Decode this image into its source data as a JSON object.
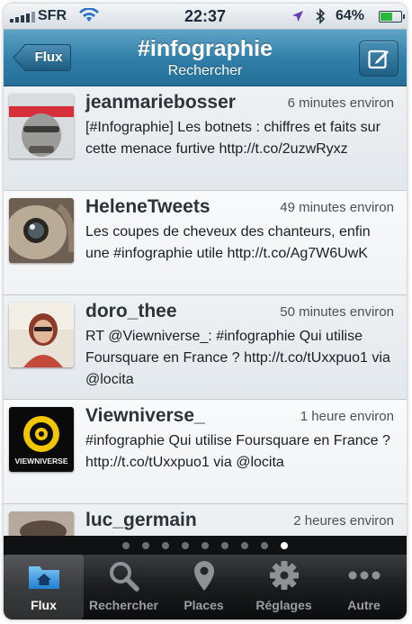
{
  "status_bar": {
    "carrier": "SFR",
    "time": "22:37",
    "battery": "64%",
    "battery_level": 0.64,
    "icons": [
      "signal-icon",
      "wifi-icon",
      "location-arrow-icon",
      "bluetooth-icon",
      "battery-icon"
    ]
  },
  "nav": {
    "back_label": "Flux",
    "title": "#infographie",
    "subtitle": "Rechercher",
    "compose_icon": "compose-icon",
    "colors": {
      "bar": "#2f7ea8",
      "title": "#ffffff"
    }
  },
  "tweets": [
    {
      "name": "jeanmariebosser",
      "time": "6 minutes environ",
      "text": "[#Infographie] Les botnets : chiffres et faits sur cette menace furtive http://t.co/2uzwRyxz"
    },
    {
      "name": "HeleneTweets",
      "time": "49 minutes environ",
      "text": "Les coupes de cheveux des chanteurs, enfin une #infographie utile http://t.co/Ag7W6UwK"
    },
    {
      "name": "doro_thee",
      "time": "50 minutes environ",
      "text": "RT @Viewniverse_: #infographie Qui utilise Foursquare en France ? http://t.co/tUxxpuo1 via @locita"
    },
    {
      "name": "Viewniverse_",
      "time": "1 heure environ",
      "text": "#infographie Qui utilise Foursquare en France ?  http://t.co/tUxxpuo1 via @locita",
      "avatar_text": "VIEWNIVERSE"
    },
    {
      "name": "luc_germain",
      "time": "2 heures environ",
      "text": ""
    }
  ],
  "pager": {
    "count": 9,
    "active_index": 8
  },
  "tabs": [
    {
      "label": "Flux",
      "icon": "home-folder-icon",
      "active": true
    },
    {
      "label": "Rechercher",
      "icon": "search-icon",
      "active": false
    },
    {
      "label": "Places",
      "icon": "map-pin-icon",
      "active": false
    },
    {
      "label": "Réglages",
      "icon": "gear-icon",
      "active": false
    },
    {
      "label": "Autre",
      "icon": "more-dots-icon",
      "active": false
    }
  ]
}
